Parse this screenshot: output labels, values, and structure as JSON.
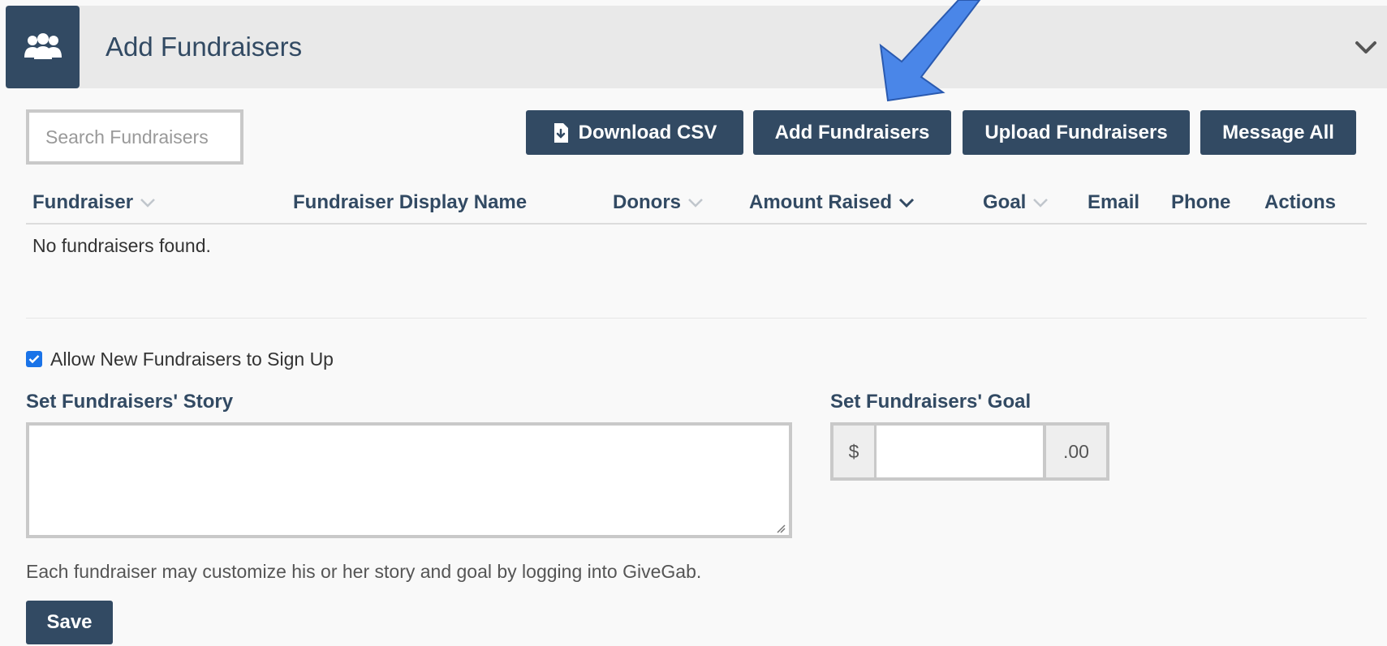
{
  "header": {
    "title": "Add Fundraisers",
    "icon": "users-icon",
    "chevron_icon": "chevron-down-icon"
  },
  "search": {
    "placeholder": "Search Fundraisers",
    "value": ""
  },
  "toolbar": {
    "download_label": "Download CSV",
    "download_icon": "file-download-icon",
    "add_label": "Add Fundraisers",
    "upload_label": "Upload Fundraisers",
    "message_label": "Message All"
  },
  "table": {
    "columns": [
      "Fundraiser",
      "Fundraiser Display Name",
      "Donors",
      "Amount Raised",
      "Goal",
      "Email",
      "Phone",
      "Actions"
    ],
    "empty_message": "No fundraisers found."
  },
  "settings": {
    "allow_signup_label": "Allow New Fundraisers to Sign Up",
    "allow_signup_checked": true,
    "story_label": "Set Fundraisers' Story",
    "story_value": "",
    "goal_label": "Set Fundraisers' Goal",
    "goal_prefix": "$",
    "goal_value": "",
    "goal_suffix": ".00",
    "help_text": "Each fundraiser may customize his or her story and goal by logging into GiveGab.",
    "save_label": "Save"
  },
  "colors": {
    "primary": "#324a63",
    "header_bg": "#e9e9e9",
    "page_bg": "#f9f9f9",
    "arrow": "#4a86e8",
    "checkbox": "#1a73e8"
  }
}
